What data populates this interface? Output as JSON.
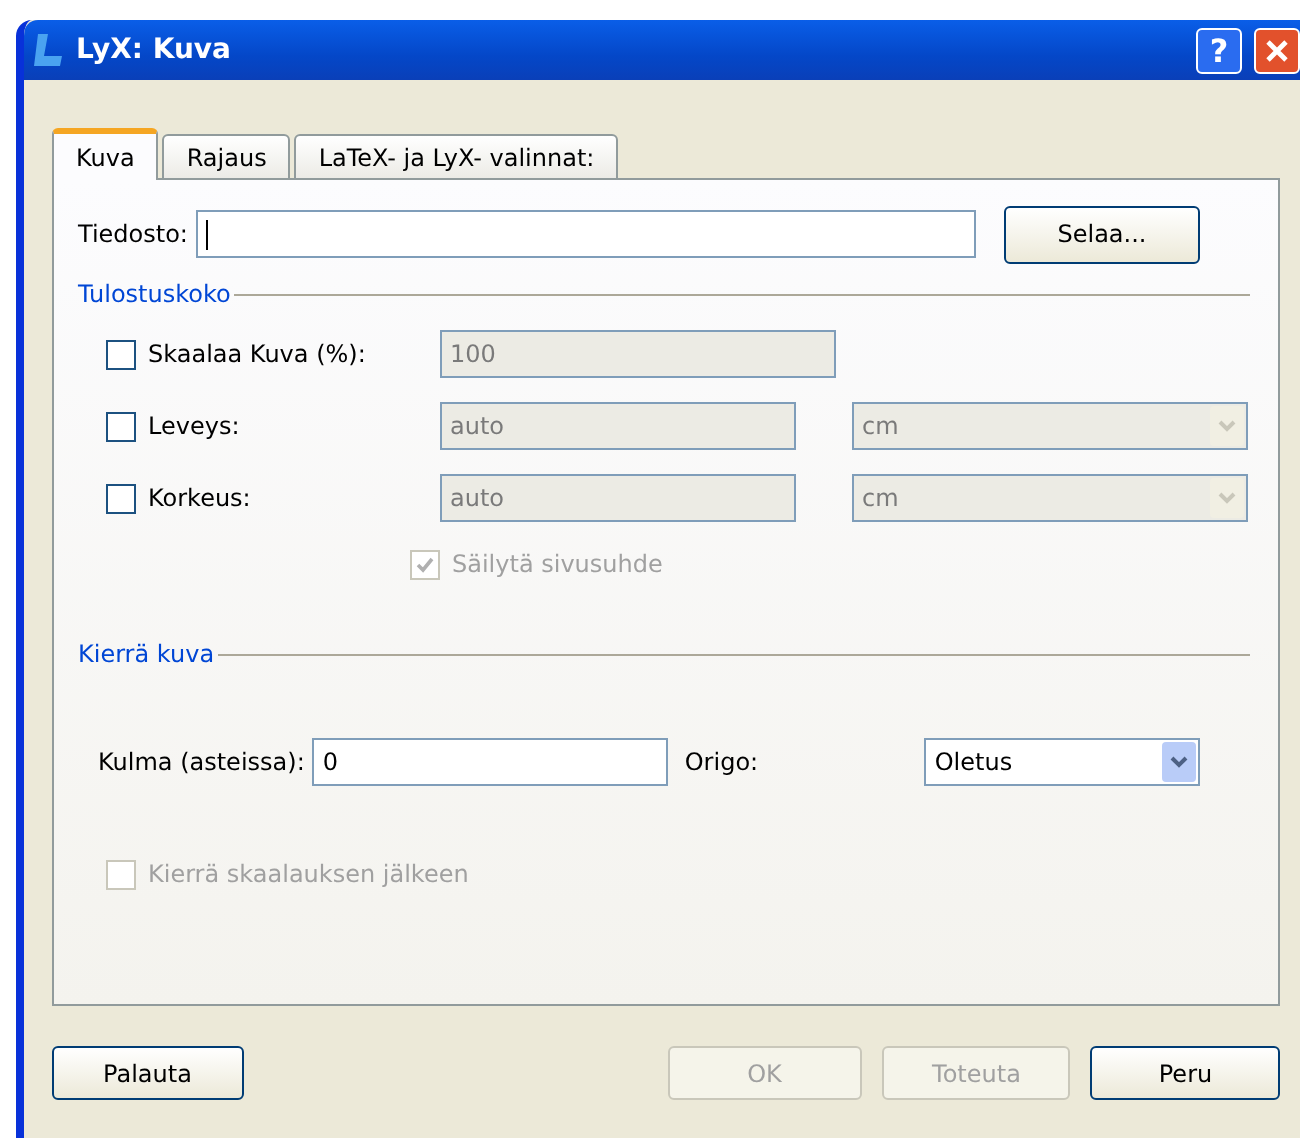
{
  "window": {
    "title": "LyX: Kuva",
    "help": "?"
  },
  "tabs": [
    {
      "label": "Kuva",
      "selected": true
    },
    {
      "label": "Rajaus",
      "selected": false
    },
    {
      "label": "LaTeX- ja LyX- valinnat:",
      "selected": false
    }
  ],
  "file": {
    "label": "Tiedosto:",
    "focused": true
  },
  "browse_button": "Selaa...",
  "size_group": {
    "title": "Tulostuskoko",
    "rows": [
      {
        "kind": "scale",
        "label": "Skaalaa Kuva (%):",
        "checked": false,
        "value": "100"
      },
      {
        "kind": "unit",
        "label": "Leveys:",
        "checked": false,
        "value": "auto",
        "unit": "cm"
      },
      {
        "kind": "unit",
        "label": "Korkeus:",
        "checked": false,
        "value": "auto",
        "unit": "cm"
      }
    ],
    "keep_ratio": {
      "label": "Säilytä sivusuhde",
      "checked": true,
      "disabled": true
    }
  },
  "rotate_group": {
    "title": "Kierrä kuva",
    "angle": {
      "label": "Kulma (asteissa):",
      "value": "0"
    },
    "origin": {
      "label": "Origo:",
      "value": "Oletus"
    },
    "rotate_after": {
      "label": "Kierrä skaalauksen jälkeen",
      "checked": false,
      "disabled": true
    }
  },
  "buttons": [
    {
      "label": "Palauta",
      "disabled": false
    },
    {
      "label": "OK",
      "disabled": true
    },
    {
      "label": "Toteuta",
      "disabled": true
    },
    {
      "label": "Peru",
      "disabled": false
    }
  ]
}
